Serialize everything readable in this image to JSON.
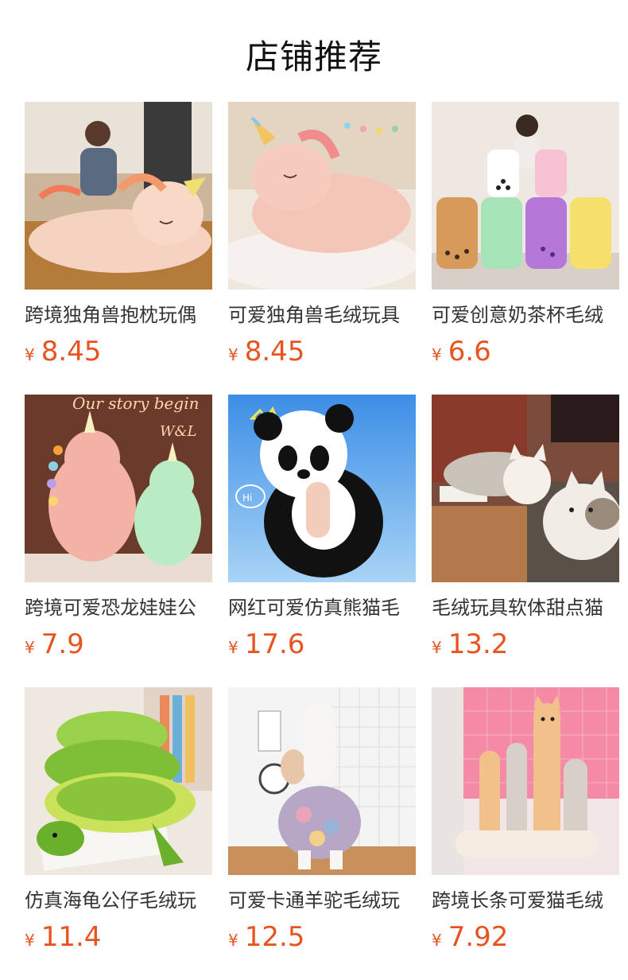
{
  "header": {
    "title": "店铺推荐"
  },
  "theme": {
    "price_color": "#e8531f",
    "text_color": "#333333"
  },
  "products": [
    {
      "name": "跨境独角兽抱枕玩偶",
      "currency": "¥",
      "price": "8.45",
      "image": "pink-unicorn-plush-with-woman-photo"
    },
    {
      "name": "可爱独角兽毛绒玩具",
      "currency": "¥",
      "price": "8.45",
      "image": "pink-unicorn-plush-on-pillow-photo"
    },
    {
      "name": "可爱创意奶茶杯毛绒",
      "currency": "¥",
      "price": "6.6",
      "image": "bubble-tea-cup-plush-photo"
    },
    {
      "name": "跨境可爱恐龙娃娃公",
      "currency": "¥",
      "price": "7.9",
      "image": "dinosaur-plush-photo",
      "sign_text": "Our story begin",
      "sign_sub": "W&L"
    },
    {
      "name": "网红可爱仿真熊猫毛",
      "currency": "¥",
      "price": "17.6",
      "image": "panda-plush-photo",
      "bubble_text": "Hi"
    },
    {
      "name": "毛绒玩具软体甜点猫",
      "currency": "¥",
      "price": "13.2",
      "image": "cat-plush-pillow-photo"
    },
    {
      "name": "仿真海龟公仔毛绒玩",
      "currency": "¥",
      "price": "11.4",
      "image": "sea-turtle-plush-photo"
    },
    {
      "name": "可爱卡通羊驼毛绒玩",
      "currency": "¥",
      "price": "12.5",
      "image": "alpaca-plush-photo"
    },
    {
      "name": "跨境长条可爱猫毛绒",
      "currency": "¥",
      "price": "7.92",
      "image": "long-cat-plush-photo"
    }
  ]
}
